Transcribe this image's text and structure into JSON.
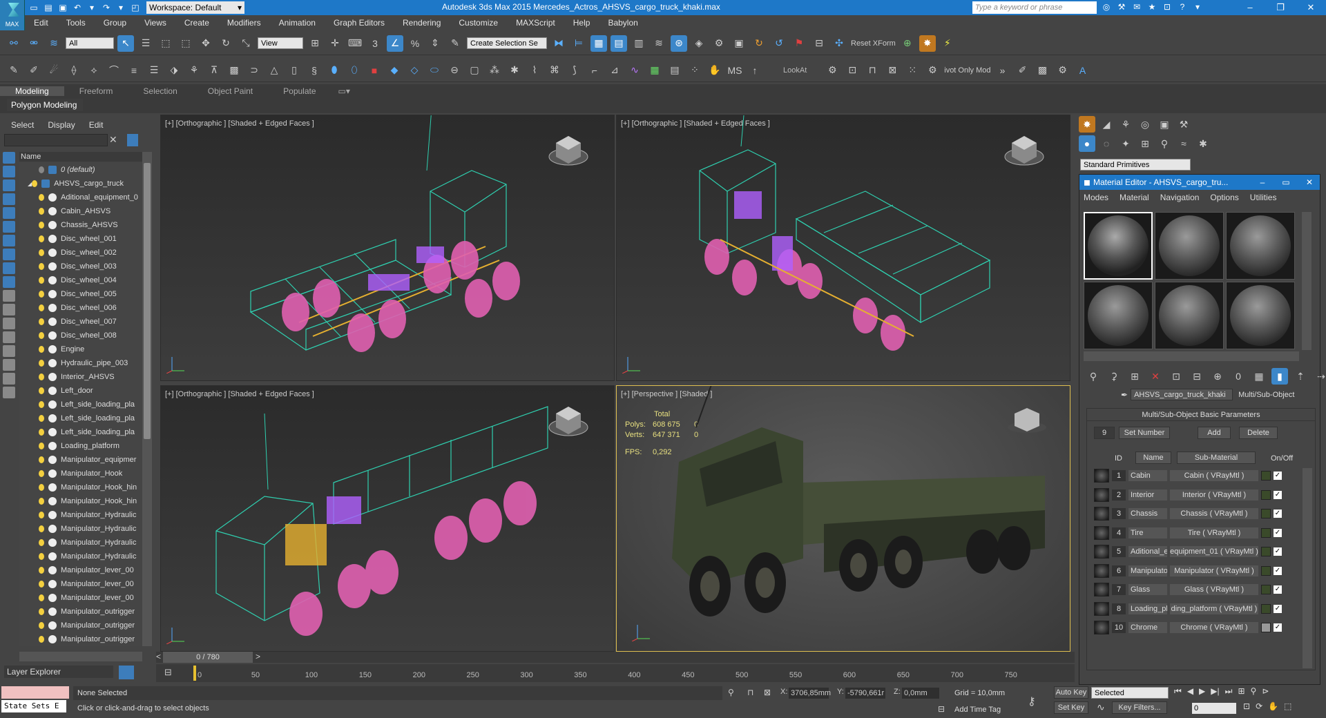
{
  "title_bar": {
    "workspace_label": "Workspace: Default",
    "title": "Autodesk 3ds Max 2015    Mercedes_Actros_AHSVS_cargo_truck_khaki.max",
    "search_placeholder": "Type a keyword or phrase",
    "logo": "MAX"
  },
  "menu": [
    "Edit",
    "Tools",
    "Group",
    "Views",
    "Create",
    "Modifiers",
    "Animation",
    "Graph Editors",
    "Rendering",
    "Customize",
    "MAXScript",
    "Help",
    "Babylon"
  ],
  "toolbar1": {
    "filter": "All",
    "view": "View",
    "selection_set": "Create Selection Se",
    "reset_xform": "Reset XForm"
  },
  "toolbar2": {
    "lookat": "LookAt",
    "pivot": "ivot Only Mod"
  },
  "ribbon": {
    "tabs": [
      "Modeling",
      "Freeform",
      "Selection",
      "Object Paint",
      "Populate"
    ],
    "active": "Modeling"
  },
  "ribbon_sub": "Polygon Modeling",
  "scene_explorer": {
    "tabs": [
      "Select",
      "Display",
      "Edit"
    ],
    "column": "Name",
    "items": [
      "0 (default)",
      "AHSVS_cargo_truck",
      "Aditional_equipment_0",
      "Cabin_AHSVS",
      "Chassis_AHSVS",
      "Disc_wheel_001",
      "Disc_wheel_002",
      "Disc_wheel_003",
      "Disc_wheel_004",
      "Disc_wheel_005",
      "Disc_wheel_006",
      "Disc_wheel_007",
      "Disc_wheel_008",
      "Engine",
      "Hydraulic_pipe_003",
      "Interior_AHSVS",
      "Left_door",
      "Left_side_loading_pla",
      "Left_side_loading_pla",
      "Left_side_loading_pla",
      "Loading_platform",
      "Manipulator_equipmer",
      "Manipulator_Hook",
      "Manipulator_Hook_hin",
      "Manipulator_Hook_hin",
      "Manipulator_Hydraulic",
      "Manipulator_Hydraulic",
      "Manipulator_Hydraulic",
      "Manipulator_Hydraulic",
      "Manipulator_lever_00",
      "Manipulator_lever_00",
      "Manipulator_lever_00",
      "Manipulator_outrigger",
      "Manipulator_outrigger",
      "Manipulator_outrigger"
    ],
    "layer_explorer": "Layer Explorer"
  },
  "viewports": {
    "tl": "[+] [Orthographic ] [Shaded + Edged Faces ]",
    "tr": "[+] [Orthographic ] [Shaded + Edged Faces ]",
    "bl": "[+] [Orthographic ] [Shaded + Edged Faces ]",
    "br": "[+] [Perspective ] [Shaded ]",
    "stats": {
      "total": "Total",
      "polys_label": "Polys:",
      "polys": "608 675",
      "polys_sel": "0",
      "verts_label": "Verts:",
      "verts": "647 371",
      "verts_sel": "0",
      "fps_label": "FPS:",
      "fps": "0,292"
    }
  },
  "timeline": {
    "position": "0 / 780",
    "ticks": [
      "0",
      "50",
      "100",
      "150",
      "200",
      "250",
      "300",
      "350",
      "400",
      "450",
      "500",
      "550",
      "600",
      "650",
      "700",
      "750"
    ]
  },
  "status": {
    "state_sets": "State Sets E",
    "selection": "None Selected",
    "prompt": "Click or click-and-drag to select objects",
    "x_label": "X:",
    "x": "3706,85mm",
    "y_label": "Y:",
    "y": "-5790,661r",
    "z_label": "Z:",
    "z": "0,0mm",
    "grid": "Grid = 10,0mm",
    "add_time_tag": "Add Time Tag",
    "auto_key": "Auto Key",
    "set_key": "Set Key",
    "key_mode": "Selected",
    "key_filters": "Key Filters...",
    "frame": "0"
  },
  "command_panel": {
    "dropdown": "Standard Primitives"
  },
  "material_editor": {
    "title": "Material Editor - AHSVS_cargo_tru...",
    "menu": [
      "Modes",
      "Material",
      "Navigation",
      "Options",
      "Utilities"
    ],
    "material_name": "AHSVS_cargo_truck_khaki",
    "material_type": "Multi/Sub-Object",
    "panel_title": "Multi/Sub-Object Basic Parameters",
    "count": "9",
    "set_number": "Set Number",
    "add": "Add",
    "delete": "Delete",
    "cols": {
      "id": "ID",
      "name": "Name",
      "sub": "Sub-Material",
      "onoff": "On/Off"
    },
    "rows": [
      {
        "id": "1",
        "name": "Cabin",
        "sub": "Cabin  ( VRayMtl )"
      },
      {
        "id": "2",
        "name": "Interior",
        "sub": "Interior  ( VRayMtl )"
      },
      {
        "id": "3",
        "name": "Chassis",
        "sub": "Chassis  ( VRayMtl )"
      },
      {
        "id": "4",
        "name": "Tire",
        "sub": "Tire  ( VRayMtl )"
      },
      {
        "id": "5",
        "name": "Aditional_e",
        "sub": "equipment_01  ( VRayMtl )"
      },
      {
        "id": "6",
        "name": "Manipulato",
        "sub": "Manipulator  ( VRayMtl )"
      },
      {
        "id": "7",
        "name": "Glass",
        "sub": "Glass  ( VRayMtl )"
      },
      {
        "id": "8",
        "name": "Loading_pl",
        "sub": "ding_platform  ( VRayMtl )"
      },
      {
        "id": "10",
        "name": "Chrome",
        "sub": "Chrome  ( VRayMtl )"
      }
    ]
  }
}
